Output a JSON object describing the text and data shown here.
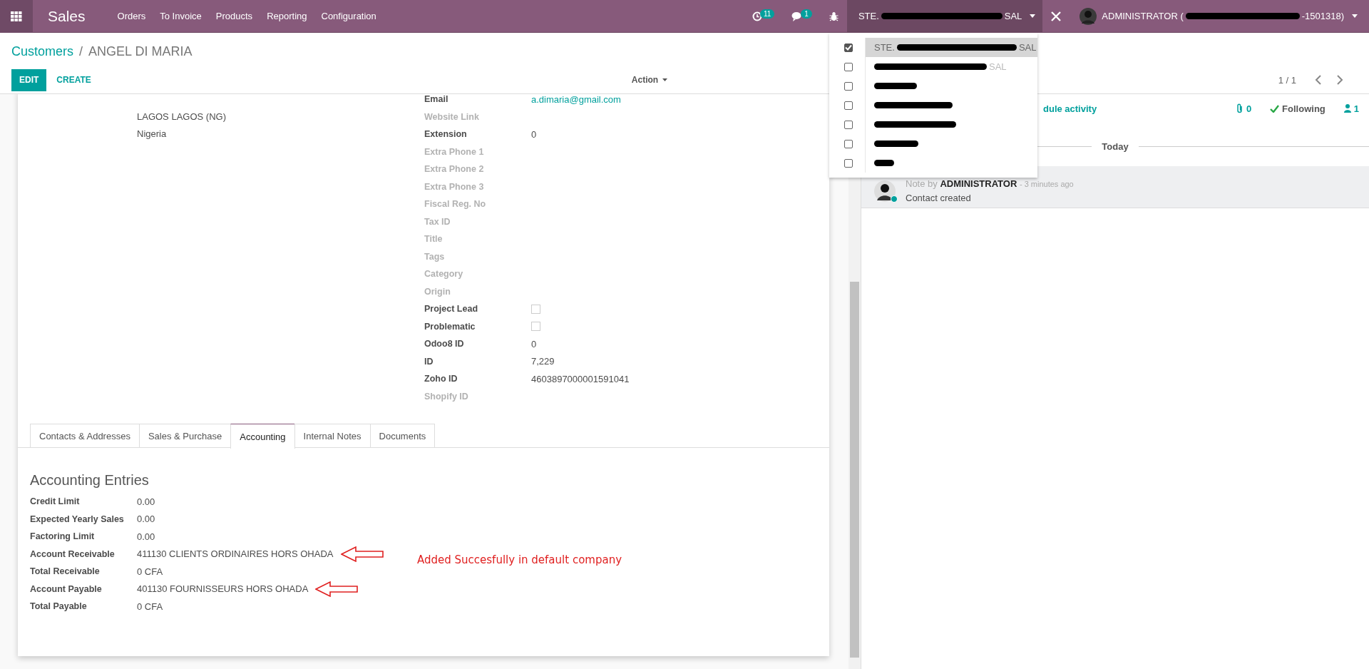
{
  "navbar": {
    "app_title": "Sales",
    "menu": [
      "Orders",
      "To Invoice",
      "Products",
      "Reporting",
      "Configuration"
    ],
    "activity_count": "11",
    "message_count": "1",
    "company": {
      "prefix": "STE.",
      "suffix": "SAL"
    },
    "user": {
      "name": "ADMINISTRATOR (",
      "suffix": "-1501318)"
    }
  },
  "breadcrumb": {
    "parent": "Customers",
    "separator": "/",
    "current": "ANGEL DI MARIA"
  },
  "buttons": [
    {
      "label": "EDIT",
      "kind": "primary"
    },
    {
      "label": "CREATE",
      "kind": "link"
    }
  ],
  "action": "Action",
  "pager": "1 / 1",
  "company_menu": [
    {
      "prefix": "STE.",
      "suffix": "SAL",
      "checked": true,
      "selected": true
    },
    {
      "suffix": "SAL",
      "checked": false,
      "selected": false
    },
    {
      "checked": false,
      "selected": false
    },
    {
      "checked": false,
      "selected": false
    },
    {
      "checked": false,
      "selected": false
    },
    {
      "checked": false,
      "selected": false
    },
    {
      "checked": false,
      "selected": false
    }
  ],
  "address_lines": [
    "LAGOS  LAGOS (NG)",
    "Nigeria"
  ],
  "fields": [
    {
      "label": "Email",
      "value": "a.dimaria@gmail.com",
      "kind": "link",
      "empty": false
    },
    {
      "label": "Website Link",
      "kind": "text",
      "empty": true
    },
    {
      "label": "Extension",
      "value": "0",
      "kind": "text",
      "empty": false
    },
    {
      "label": "Extra Phone 1",
      "kind": "text",
      "empty": true
    },
    {
      "label": "Extra Phone 2",
      "kind": "text",
      "empty": true
    },
    {
      "label": "Extra Phone 3",
      "kind": "text",
      "empty": true
    },
    {
      "label": "Fiscal Reg. No",
      "kind": "text",
      "empty": true
    },
    {
      "label": "Tax ID",
      "kind": "text",
      "empty": true
    },
    {
      "label": "Title",
      "kind": "text",
      "empty": true
    },
    {
      "label": "Tags",
      "kind": "text",
      "empty": true
    },
    {
      "label": "Category",
      "kind": "text",
      "empty": true
    },
    {
      "label": "Origin",
      "kind": "text",
      "empty": true
    },
    {
      "label": "Project Lead",
      "kind": "checkbox",
      "checked": false,
      "empty": false
    },
    {
      "label": "Problematic",
      "kind": "checkbox",
      "checked": false,
      "empty": false
    },
    {
      "label": "Odoo8 ID",
      "value": "0",
      "kind": "text",
      "empty": false
    },
    {
      "label": "ID",
      "value": "7,229",
      "kind": "text",
      "empty": false
    },
    {
      "label": "Zoho ID",
      "value": "4603897000001591041",
      "kind": "text",
      "empty": false
    },
    {
      "label": "Shopify ID",
      "kind": "text",
      "empty": true
    }
  ],
  "tabs": [
    {
      "label": "Contacts & Addresses",
      "selected": false
    },
    {
      "label": "Sales & Purchase",
      "selected": false
    },
    {
      "label": "Accounting",
      "selected": true
    },
    {
      "label": "Internal Notes",
      "selected": false
    },
    {
      "label": "Documents",
      "selected": false
    }
  ],
  "accounting": {
    "title": "Accounting Entries",
    "rows": [
      {
        "label": "Credit Limit",
        "value": "0.00",
        "annotated": false
      },
      {
        "label": "Expected Yearly Sales",
        "value": "0.00",
        "annotated": false
      },
      {
        "label": "Factoring Limit",
        "value": "0.00",
        "annotated": false
      },
      {
        "label": "Account Receivable",
        "value": "411130 CLIENTS ORDINAIRES HORS OHADA",
        "annotated": true
      },
      {
        "label": "Total Receivable",
        "value": "0 CFA",
        "annotated": false
      },
      {
        "label": "Account Payable",
        "value": "401130 FOURNISSEURS HORS OHADA",
        "annotated": true
      },
      {
        "label": "Total Payable",
        "value": "0 CFA",
        "annotated": false
      }
    ]
  },
  "annotation": {
    "text": "Added Succesfully in default company"
  },
  "chatter": {
    "activity_link": "dule activity",
    "attachments": "0",
    "follow": "Following",
    "followers": "1",
    "date_separator": "Today",
    "messages": [
      {
        "prefix": "Note by",
        "author": "ADMINISTRATOR",
        "time": "- 3 minutes ago",
        "body": "Contact created",
        "online": true
      }
    ]
  }
}
